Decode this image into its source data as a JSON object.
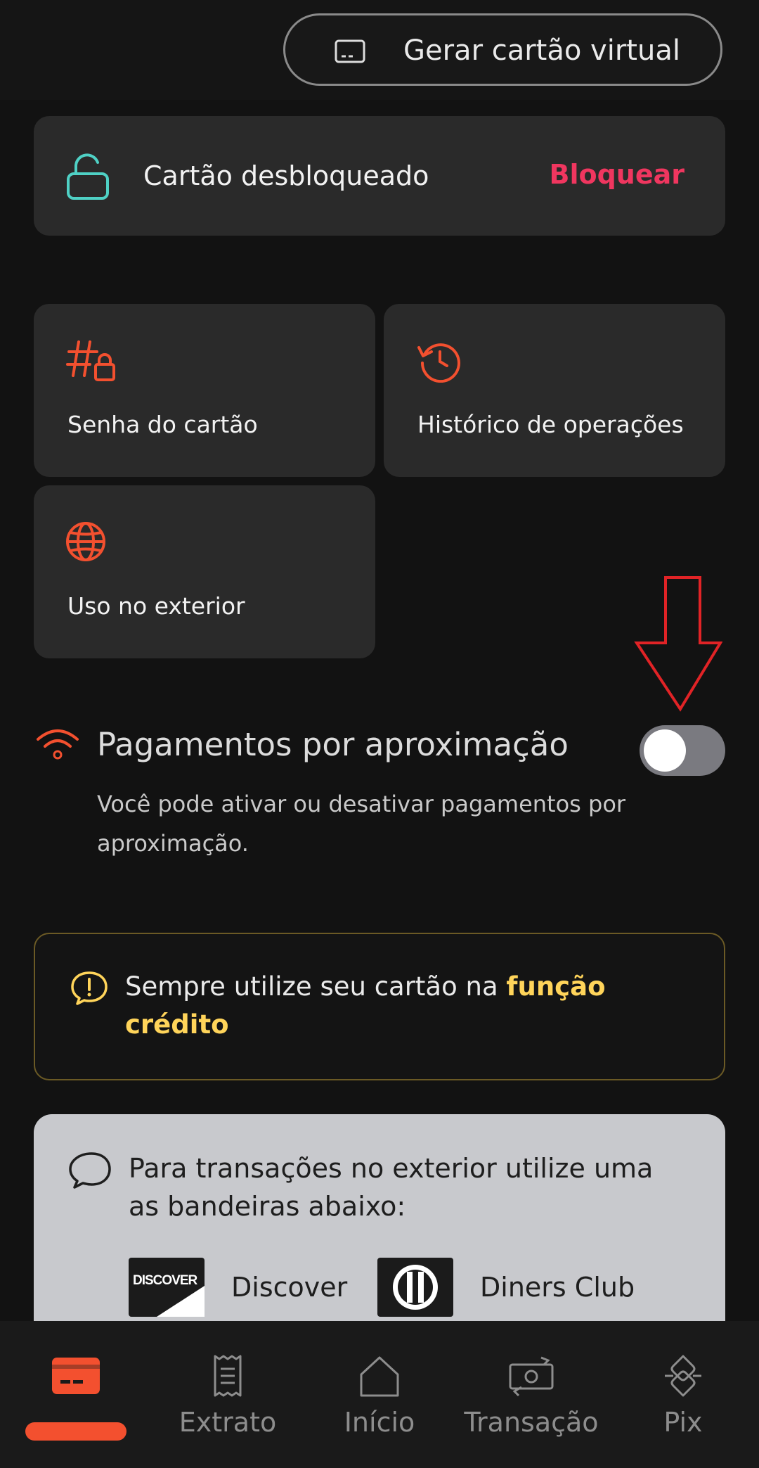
{
  "header": {
    "virtual_card_label": "Gerar cartão virtual",
    "virtual_card_icon": "card-outline-icon"
  },
  "lock_status": {
    "title": "Cartão desbloqueado",
    "action_label": "Bloquear",
    "icon": "unlock-icon",
    "icon_color": "#4fd1c5",
    "action_color": "#f0365f"
  },
  "tiles": [
    {
      "label": "Senha do cartão",
      "icon": "hash-lock-icon"
    },
    {
      "label": "Histórico de operações",
      "icon": "history-icon"
    },
    {
      "label": "Uso no exterior",
      "icon": "globe-icon"
    }
  ],
  "contactless": {
    "title": "Pagamentos por aproximação",
    "description": "Você pode ativar ou desativar pagamentos por aproximação.",
    "enabled": false,
    "icon": "wifi-icon"
  },
  "warning": {
    "text_before": "Sempre utilize seu cartão na ",
    "highlight": "função crédito",
    "icon": "alert-chat-icon",
    "highlight_color": "#ffd45a"
  },
  "info": {
    "text": "Para transações no exterior utilize uma as bandeiras abaixo:",
    "icon": "chat-bubble-icon",
    "brands": [
      {
        "name": "Discover",
        "logo_text": "DISCOVER"
      },
      {
        "name": "Diners Club"
      }
    ]
  },
  "nav": {
    "items": [
      {
        "label": "",
        "icon": "card-icon",
        "active": true
      },
      {
        "label": "Extrato",
        "icon": "receipt-icon"
      },
      {
        "label": "Início",
        "icon": "home-icon"
      },
      {
        "label": "Transação",
        "icon": "money-transfer-icon"
      },
      {
        "label": "Pix",
        "icon": "pix-icon"
      }
    ],
    "accent_color": "#f3502f"
  }
}
